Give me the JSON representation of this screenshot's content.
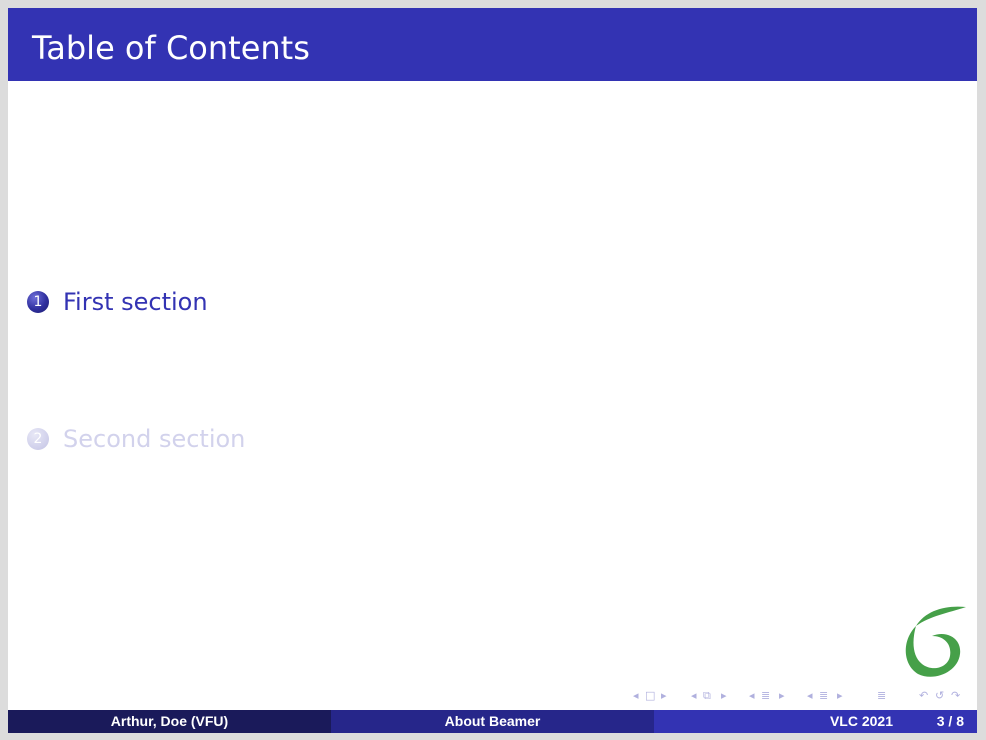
{
  "frame": {
    "title": "Table of Contents"
  },
  "toc": {
    "items": [
      {
        "number": "1",
        "label": "First section",
        "state": "current"
      },
      {
        "number": "2",
        "label": "Second section",
        "state": "shaded"
      }
    ]
  },
  "logo": {
    "icon": "overleaf-leaf-logo",
    "color": "#46a049"
  },
  "navigation": {
    "symbols": [
      "◂",
      "□",
      "▸",
      "◂",
      "⧉",
      "▸",
      "◂",
      "≣",
      "▸",
      "◂",
      "≣",
      "▸",
      "≣",
      "↶",
      "↺",
      "↷"
    ]
  },
  "footline": {
    "author": "Arthur, Doe  (VFU)",
    "title": "About Beamer",
    "date": "VLC 2021",
    "page": "3 / 8"
  },
  "colors": {
    "theme": "#3333b3",
    "footer_dark": "#1a1a5a",
    "footer_mid": "#26268a",
    "shaded_text": "#d2d2ec"
  }
}
